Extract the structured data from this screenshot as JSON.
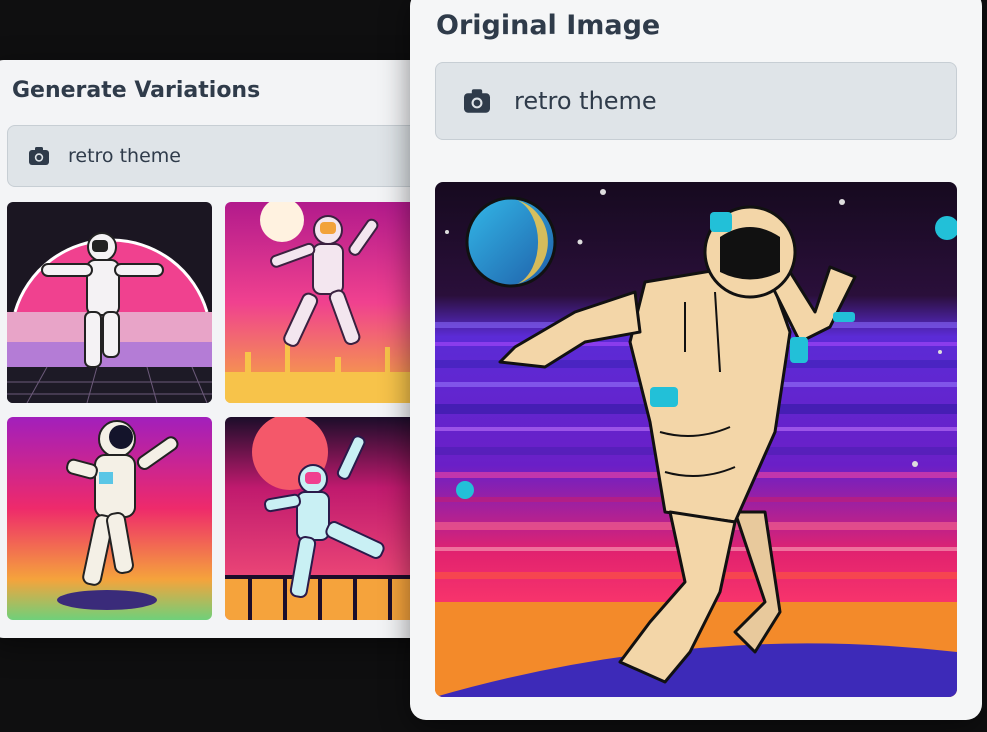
{
  "variations_panel": {
    "title": "Generate Variations",
    "prompt": {
      "icon": "camera-icon",
      "text": "retro theme"
    },
    "thumbnails": [
      {
        "name": "variation-1"
      },
      {
        "name": "variation-2"
      },
      {
        "name": "variation-3"
      },
      {
        "name": "variation-4"
      }
    ]
  },
  "original_panel": {
    "title": "Original Image",
    "prompt": {
      "icon": "camera-icon",
      "text": "retro theme"
    }
  },
  "colors": {
    "background": "#0f0f10",
    "card": "#f3f4f6",
    "prompt_box": "#dfe4e8",
    "title_text": "#2f3b4a"
  }
}
